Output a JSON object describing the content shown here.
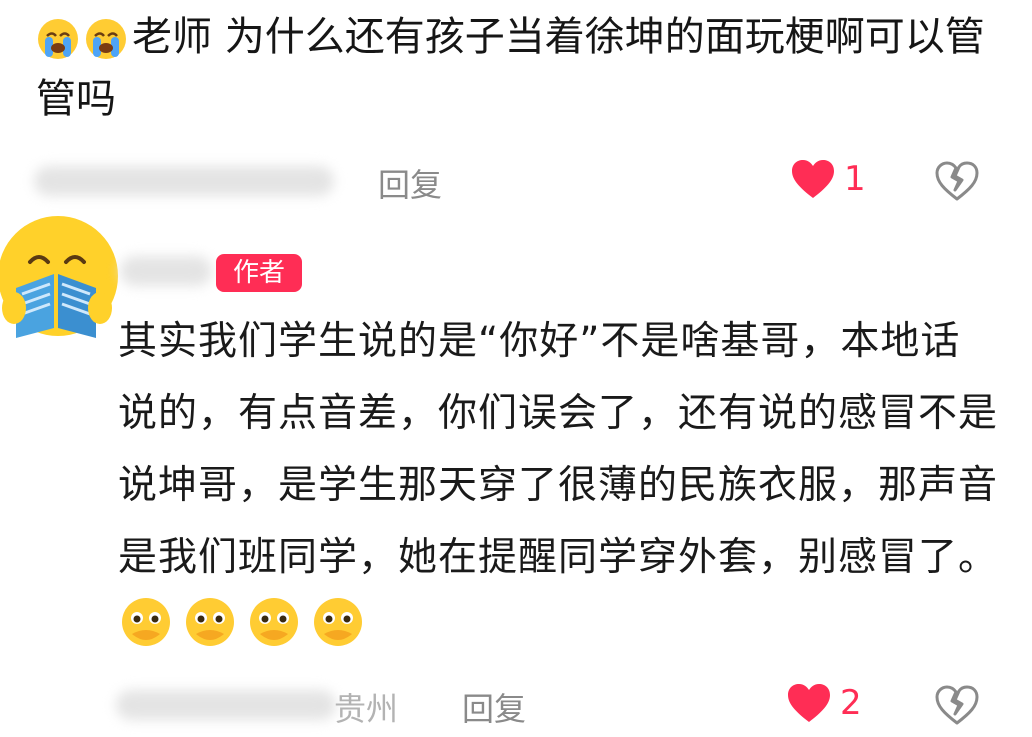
{
  "comment1": {
    "emojis": [
      "loudly-crying-face",
      "loudly-crying-face"
    ],
    "text": "老师 为什么还有孩子当着徐坤的面玩梗啊可以管管吗",
    "reply_label": "回复",
    "like_count": "1",
    "liked": true
  },
  "comment2": {
    "author_badge": "作者",
    "text": "其实我们学生说的是“你好”不是啥基哥，本地话说的，有点音差，你们误会了，还有说的感冒不是说坤哥，是学生那天穿了很薄的民族衣服，那声音是我们班同学，她在提醒同学穿外套，别感冒了。",
    "trailing_emojis": [
      "face-holding-back-tears",
      "face-holding-back-tears",
      "face-holding-back-tears",
      "face-holding-back-tears"
    ],
    "location": "贵州",
    "reply_label": "回复",
    "like_count": "2",
    "liked": true
  },
  "colors": {
    "accent": "#ff2d55",
    "muted": "#8a8a8a"
  }
}
